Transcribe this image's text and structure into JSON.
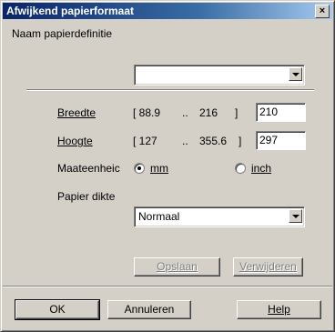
{
  "window": {
    "title": "Afwijkend papierformaat",
    "close_glyph": "×"
  },
  "definition": {
    "label": "Naam papierdefinitie",
    "value": ""
  },
  "width": {
    "label": "Breedte",
    "range_min": "[ 88.9",
    "range_sep": "..",
    "range_max": "216",
    "range_close": "]",
    "value": "210"
  },
  "height": {
    "label": "Hoogte",
    "range_min": "[ 127",
    "range_sep": "..",
    "range_max": "355.6",
    "range_close": "]",
    "value": "297"
  },
  "unit": {
    "label": "Maateenheic",
    "options": [
      "mm",
      "inch"
    ],
    "selected": "mm"
  },
  "thickness": {
    "label": "Papier dikte",
    "value": "Normaal"
  },
  "actions": {
    "save": "Opslaan",
    "delete": "Verwijderen"
  },
  "footer": {
    "ok": "OK",
    "cancel": "Annuleren",
    "help": "Help"
  }
}
